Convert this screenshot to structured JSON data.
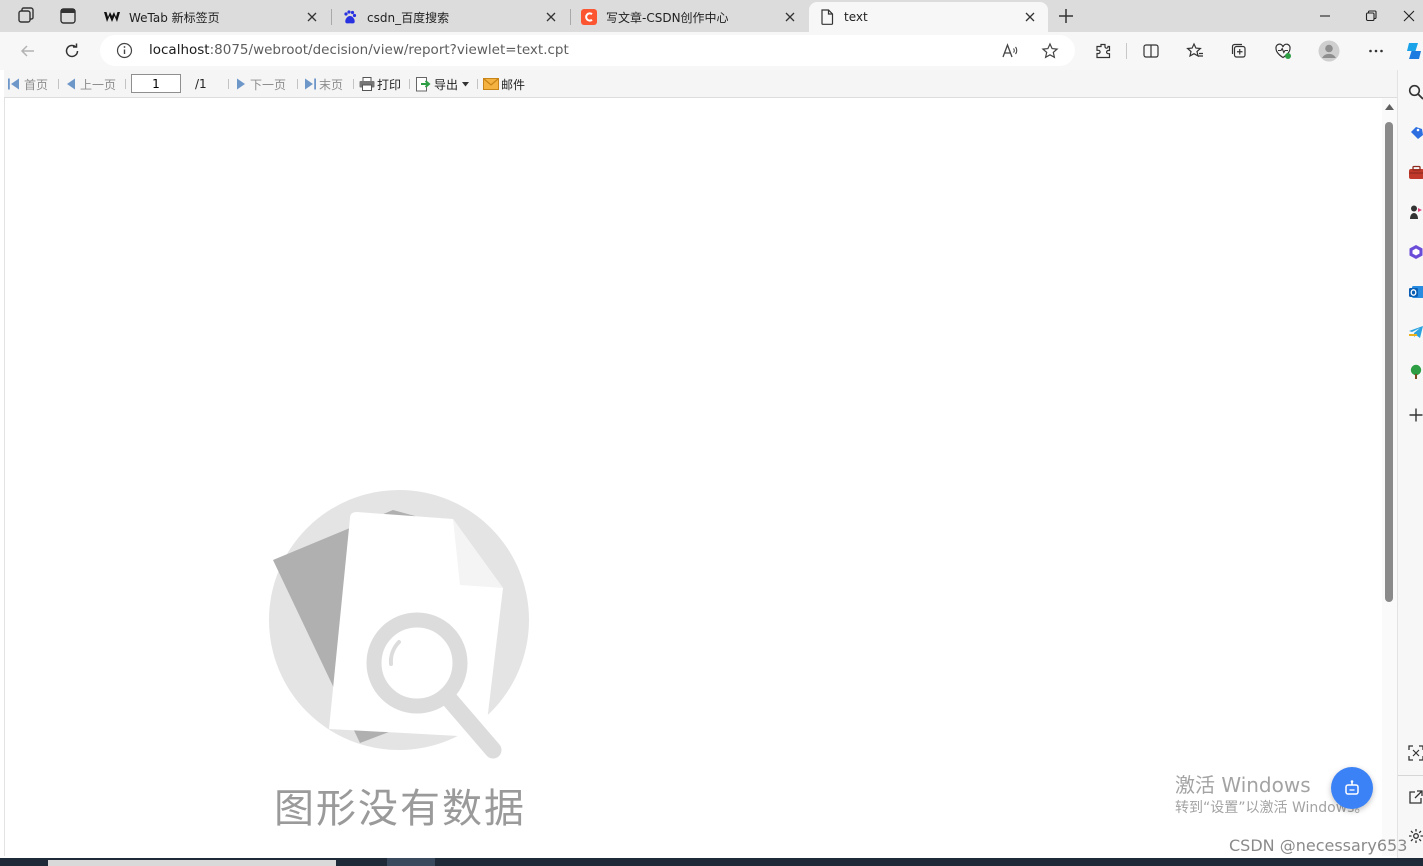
{
  "browser": {
    "tabs": [
      {
        "title": "WeTab 新标签页",
        "active": false
      },
      {
        "title": "csdn_百度搜索",
        "active": false
      },
      {
        "title": "写文章-CSDN创作中心",
        "active": false
      },
      {
        "title": "text",
        "active": true
      }
    ],
    "address": {
      "host": "localhost",
      "rest": ":8075/webroot/decision/view/report?viewlet=text.cpt"
    }
  },
  "report_toolbar": {
    "first_page": "首页",
    "prev_page": "上一页",
    "page_input": "1",
    "page_total": "/1",
    "next_page": "下一页",
    "last_page": "末页",
    "print": "打印",
    "export": "导出",
    "email": "邮件"
  },
  "report": {
    "no_data_text": "图形没有数据"
  },
  "overlay": {
    "activate_title": "激活 Windows",
    "activate_sub": "转到“设置”以激活 Windows。",
    "watermark": "CSDN @necessary653"
  },
  "colors": {
    "accent": "#3b82f6",
    "csdn_red": "#fc5531",
    "baidu_blue": "#2932e1",
    "export_green": "#2e9e45",
    "mail_orange": "#f0a030"
  },
  "icons": [
    "workspaces-icon",
    "tab-actions-icon",
    "wetab-favicon",
    "baidu-favicon",
    "csdn-favicon",
    "page-favicon",
    "close-icon",
    "new-tab-icon",
    "minimize-icon",
    "restore-icon",
    "back-icon",
    "refresh-icon",
    "info-icon",
    "read-aloud-icon",
    "favorite-star-icon",
    "extensions-icon",
    "split-screen-icon",
    "favorites-icon",
    "collections-icon",
    "browser-essentials-icon",
    "profile-avatar",
    "more-icon",
    "copilot-icon",
    "search-icon",
    "plus-icon",
    "settings-icon"
  ]
}
